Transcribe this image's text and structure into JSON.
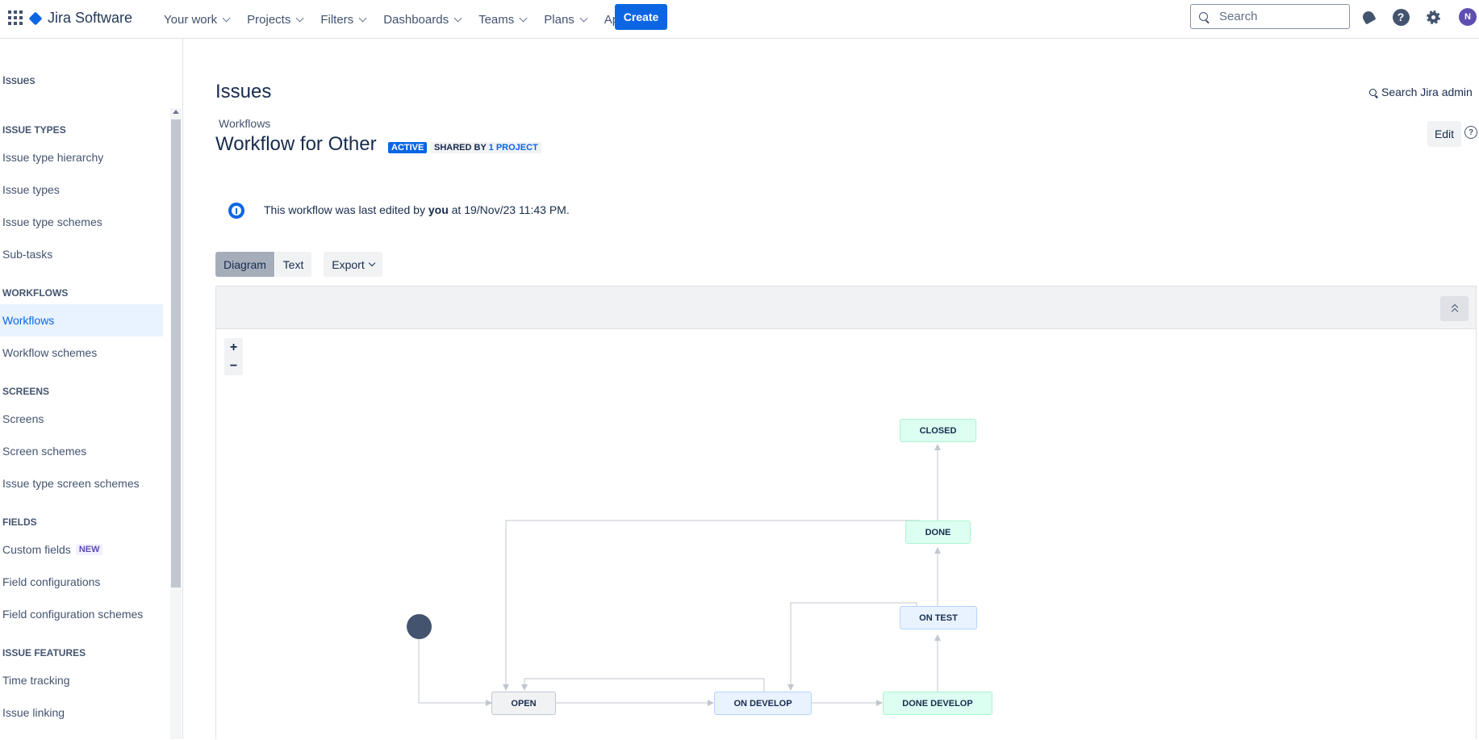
{
  "topnav": {
    "product": "Jira Software",
    "items": [
      "Your work",
      "Projects",
      "Filters",
      "Dashboards",
      "Teams",
      "Plans",
      "Apps"
    ],
    "create_label": "Create",
    "search_placeholder": "Search",
    "avatar_initial": "N",
    "help_glyph": "?"
  },
  "sidebar": {
    "title": "Issues",
    "sections": {
      "issue_types": "ISSUE TYPES",
      "workflows": "WORKFLOWS",
      "screens": "SCREENS",
      "fields": "FIELDS",
      "issue_features": "ISSUE FEATURES"
    },
    "items": {
      "issue_type_hierarchy": "Issue type hierarchy",
      "issue_types": "Issue types",
      "issue_type_schemes": "Issue type schemes",
      "sub_tasks": "Sub-tasks",
      "workflows": "Workflows",
      "workflow_schemes": "Workflow schemes",
      "screens": "Screens",
      "screen_schemes": "Screen schemes",
      "issue_type_screen_schemes": "Issue type screen schemes",
      "custom_fields": "Custom fields",
      "field_configurations": "Field configurations",
      "field_configuration_schemes": "Field configuration schemes",
      "time_tracking": "Time tracking",
      "issue_linking": "Issue linking"
    },
    "new_badge": "NEW"
  },
  "main": {
    "title": "Issues",
    "search_admin": "Search Jira admin",
    "breadcrumb": "Workflows",
    "workflow_title": "Workflow for Other",
    "active_badge": "ACTIVE",
    "shared_prefix": "SHARED BY",
    "shared_link": "1 PROJECT",
    "edit_label": "Edit",
    "help_glyph": "?",
    "info": {
      "prefix": "This workflow was last edited by",
      "user": "you",
      "at": "at",
      "timestamp": "19/Nov/23 11:43 PM."
    },
    "tabs": {
      "diagram": "Diagram",
      "text": "Text",
      "export": "Export"
    },
    "zoom_in": "+",
    "zoom_out": "−"
  },
  "statuses": {
    "open": "OPEN",
    "on_develop": "ON DEVELOP",
    "done_develop": "DONE DEVELOP",
    "on_test": "ON TEST",
    "done": "DONE",
    "closed": "CLOSED"
  },
  "colors": {
    "brand": "#0C66E4",
    "todo": "#F1F2F4",
    "in_progress": "#E9F2FF",
    "done": "#DCFFF1"
  }
}
